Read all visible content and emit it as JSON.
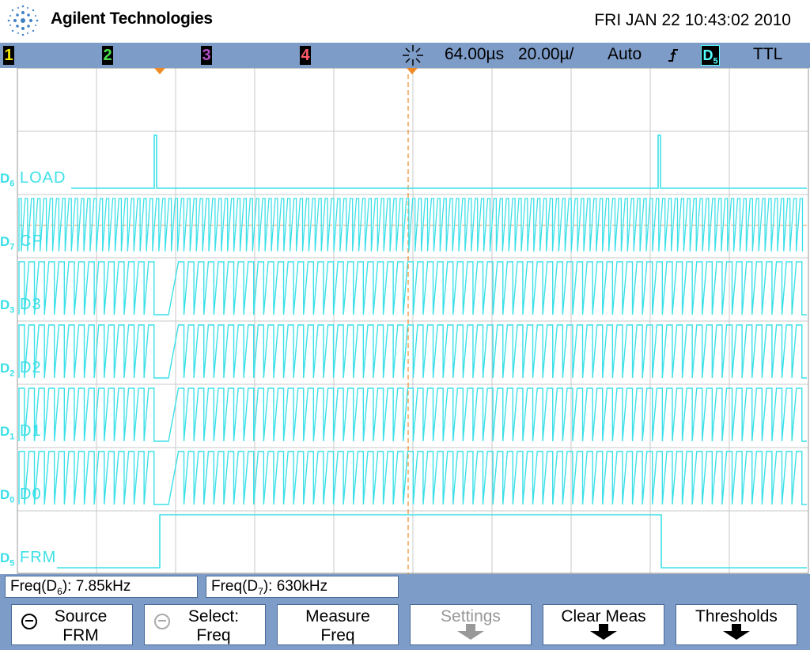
{
  "header": {
    "brand": "Agilent Technologies",
    "datetime": "FRI JAN 22 10:43:02 2010"
  },
  "statusbar": {
    "channels": [
      {
        "label": "1",
        "color": "#f2e600"
      },
      {
        "label": "2",
        "color": "#4de04d"
      },
      {
        "label": "3",
        "color": "#b14ec4"
      },
      {
        "label": "4",
        "color": "#ff5a6a"
      }
    ],
    "delay": "64.00µs",
    "timebase": "20.00µ/",
    "trigger_mode": "Auto",
    "trigger_slope_icon": "rising-edge-icon",
    "trigger_source": "D5",
    "threshold": "TTL"
  },
  "display": {
    "trace_color": "#3ce0e8",
    "traces": [
      {
        "channel": "D6",
        "name": "LOAD"
      },
      {
        "channel": "D7",
        "name": "CP"
      },
      {
        "channel": "D3",
        "name": "D3"
      },
      {
        "channel": "D2",
        "name": "D2"
      },
      {
        "channel": "D1",
        "name": "D1"
      },
      {
        "channel": "D0",
        "name": "D0"
      },
      {
        "channel": "D5",
        "name": "FRM"
      }
    ]
  },
  "measurements": [
    {
      "label": "Freq(D6): 7.85kHz"
    },
    {
      "label": "Freq(D7): 630kHz"
    }
  ],
  "softkeys": [
    {
      "line1": "Source",
      "line2": "FRM",
      "icon": "knob-icon",
      "enabled": true
    },
    {
      "line1": "Select:",
      "line2": "Freq",
      "icon": "knob-icon",
      "enabled": true
    },
    {
      "line1": "Measure",
      "line2": "Freq",
      "enabled": true
    },
    {
      "line1": "Settings",
      "line2": "",
      "icon": "down-arrow-icon",
      "enabled": false
    },
    {
      "line1": "Clear Meas",
      "line2": "",
      "icon": "down-arrow-icon",
      "enabled": true
    },
    {
      "line1": "Thresholds",
      "line2": "",
      "icon": "down-arrow-icon",
      "enabled": true
    }
  ]
}
